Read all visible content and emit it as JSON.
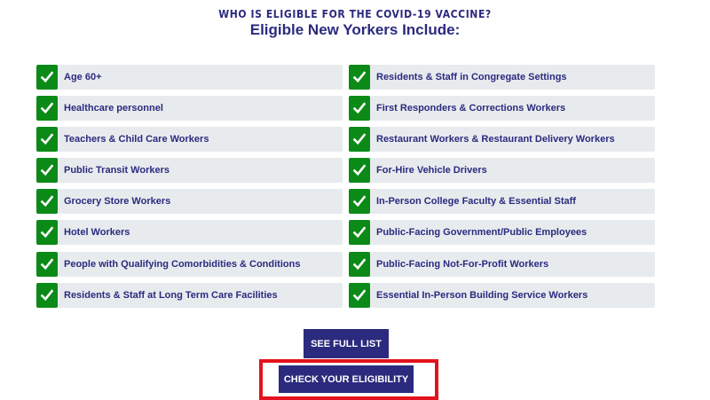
{
  "header": {
    "eyebrow": "WHO IS ELIGIBLE FOR THE COVID-19 VACCINE?",
    "title": "Eligible New Yorkers Include:"
  },
  "eligibility_list": {
    "left": [
      {
        "label": "Age 60+"
      },
      {
        "label": "Healthcare personnel"
      },
      {
        "label": "Teachers & Child Care Workers"
      },
      {
        "label": "Public Transit Workers"
      },
      {
        "label": "Grocery Store Workers"
      },
      {
        "label": "Hotel Workers"
      },
      {
        "label": "People with Qualifying Comorbidities & Conditions"
      },
      {
        "label": "Residents & Staff at Long Term Care Facilities"
      }
    ],
    "right": [
      {
        "label": "Residents & Staff in Congregate Settings"
      },
      {
        "label": "First Responders & Corrections Workers"
      },
      {
        "label": "Restaurant Workers & Restaurant Delivery Workers"
      },
      {
        "label": "For-Hire Vehicle Drivers"
      },
      {
        "label": "In-Person College Faculty & Essential Staff"
      },
      {
        "label": "Public-Facing Government/Public Employees"
      },
      {
        "label": "Public-Facing Not-For-Profit Workers"
      },
      {
        "label": "Essential In-Person Building Service Workers"
      }
    ],
    "icon": "checkmark-icon"
  },
  "actions": {
    "see_full_list": "SEE FULL LIST",
    "check_eligibility": "CHECK YOUR ELIGIBILITY"
  },
  "colors": {
    "brand_navy": "#2b2a7e",
    "check_green": "#0c8a17",
    "row_background": "#e7ebee",
    "highlight_red": "#e3121c"
  }
}
